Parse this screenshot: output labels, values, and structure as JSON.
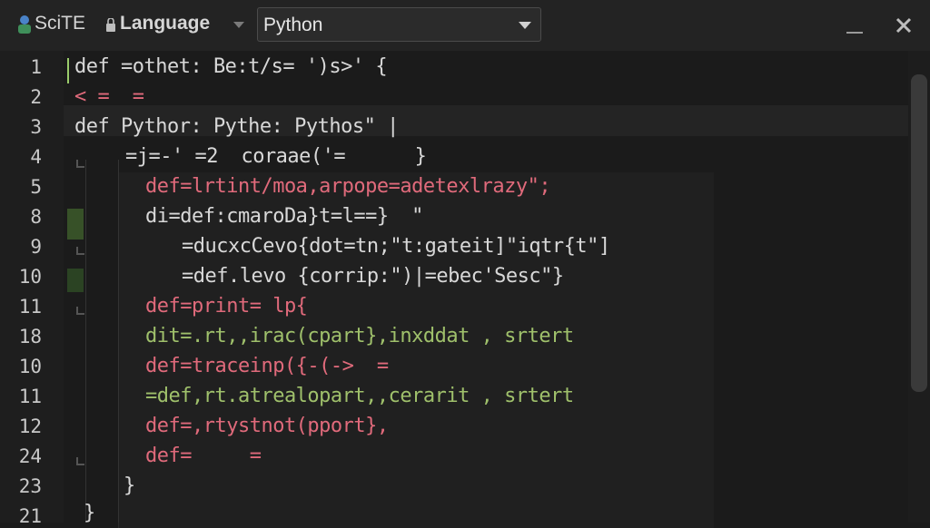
{
  "window": {
    "app_name": "SciTE",
    "language_label": "Language",
    "language_value": "Python"
  },
  "gutter": {
    "line_numbers": [
      "1",
      "2",
      "3",
      "4",
      "5",
      "8",
      "9",
      "10",
      "11",
      "18",
      "10",
      "11",
      "12",
      "24",
      "23",
      "21"
    ]
  },
  "code_lines": [
    "def =othet: Be:t/s= ')s>' {",
    "< =  =",
    "def Pythor: Pythe: Pythos\" |",
    "=j=-' =2  coraae('=      }",
    "def=lrtint/moa,arpope=adetexlrazy\";",
    "di=def:cmaroDa}t=l==}  \"",
    "=ducxcCevo{dot=tn;\"t:gateit]\"iqtr{t\"]",
    "=def.levo {corrip:\")|=ebec'Sesc\"}",
    "def=print= lp{",
    "dit=.rt,,irac(cpart},inxddat , srtert",
    "def=traceinp({-(->  =",
    "=def,rt.atrealopart,,cerarit , srtert",
    "def=,rtystnot(pport},",
    "def=     =",
    "}",
    "}"
  ],
  "colors": {
    "background": "#1b1b1b",
    "keyword": "#e06a7b",
    "accent_green": "#9fc06b"
  },
  "icons": [
    "scite-logo-icon",
    "language-icon",
    "chevron-down-icon",
    "minimize-icon",
    "close-icon"
  ]
}
